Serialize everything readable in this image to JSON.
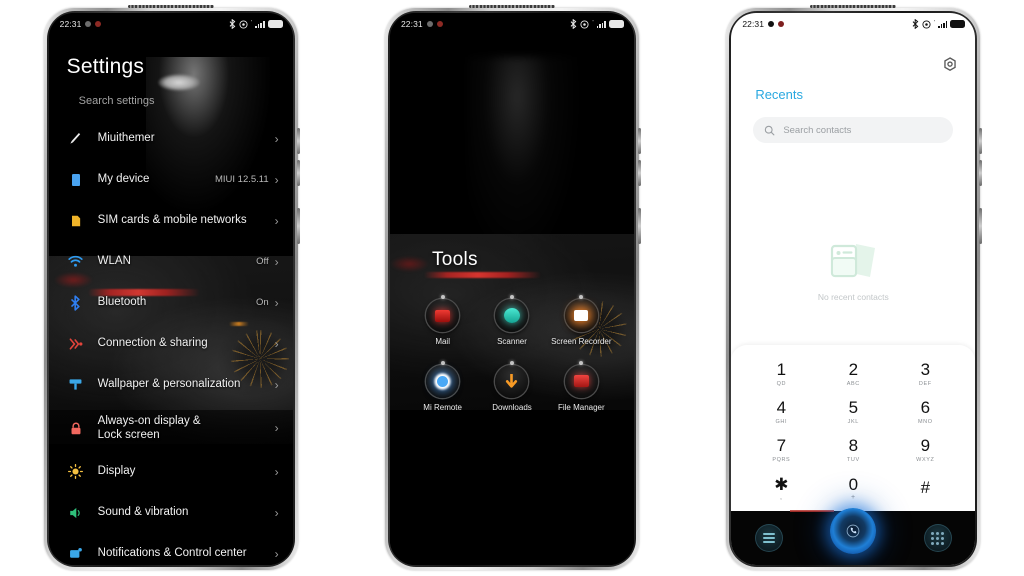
{
  "statusbar": {
    "time": "22:31",
    "icons_left": [
      "status-dot-gray",
      "status-dot-red"
    ],
    "icons_right": [
      "bluetooth-icon",
      "dnd-icon",
      "signal-icon",
      "battery-icon"
    ]
  },
  "phone1": {
    "name": "settings-screen",
    "title": "Settings",
    "search_placeholder": "Search settings",
    "items": [
      {
        "label": "Miuithemer",
        "value": "",
        "icon": "brush-icon",
        "color": "#e8e8e8"
      },
      {
        "label": "My device",
        "value": "MIUI 12.5.11",
        "icon": "device-icon",
        "color": "#4aa3f0"
      },
      {
        "label": "SIM cards & mobile networks",
        "value": "",
        "icon": "sim-card-icon",
        "color": "#f0b429"
      },
      {
        "label": "WLAN",
        "value": "Off",
        "icon": "wifi-icon",
        "color": "#2f9bf0"
      },
      {
        "label": "Bluetooth",
        "value": "On",
        "icon": "bluetooth-icon",
        "color": "#2f7ef0"
      },
      {
        "label": "Connection & sharing",
        "value": "",
        "icon": "connection-icon",
        "color": "#e2443b"
      },
      {
        "label": "Wallpaper & personalization",
        "value": "",
        "icon": "wallpaper-icon",
        "color": "#3aa7e8"
      },
      {
        "label": "Always-on display & Lock screen",
        "value": "",
        "icon": "lock-icon",
        "color": "#f2685f"
      },
      {
        "label": "Display",
        "value": "",
        "icon": "brightness-icon",
        "color": "#f5c141"
      },
      {
        "label": "Sound & vibration",
        "value": "",
        "icon": "volume-icon",
        "color": "#2fc07a"
      },
      {
        "label": "Notifications & Control center",
        "value": "",
        "icon": "notification-icon",
        "color": "#3aa7e8"
      }
    ],
    "chevron": "›"
  },
  "phone2": {
    "name": "tools-folder-screen",
    "folder_title": "Tools",
    "apps": [
      {
        "label": "Mail",
        "icon": "mail-icon",
        "color": "#d4201d"
      },
      {
        "label": "Scanner",
        "icon": "scanner-icon",
        "color": "#2fd6c2"
      },
      {
        "label": "Screen Recorder",
        "icon": "screen-recorder-icon",
        "color": "#f07c1e"
      },
      {
        "label": "Mi Remote",
        "icon": "mi-remote-icon",
        "color": "#1f8ae0"
      },
      {
        "label": "Downloads",
        "icon": "download-icon",
        "color": "#f0921e"
      },
      {
        "label": "File Manager",
        "icon": "file-manager-icon",
        "color": "#d4201d"
      }
    ]
  },
  "phone3": {
    "name": "dialer-screen",
    "tab_title": "Recents",
    "tab_color": "#29a8e0",
    "settings_icon": "gear-icon",
    "search_placeholder": "Search contacts",
    "empty_state": {
      "icon": "no-contacts-illustration",
      "text": "No recent contacts"
    },
    "keypad": [
      {
        "num": "1",
        "sub": "QD"
      },
      {
        "num": "2",
        "sub": "ABC"
      },
      {
        "num": "3",
        "sub": "DEF"
      },
      {
        "num": "4",
        "sub": "GHI"
      },
      {
        "num": "5",
        "sub": "JKL"
      },
      {
        "num": "6",
        "sub": "MNO"
      },
      {
        "num": "7",
        "sub": "PQRS"
      },
      {
        "num": "8",
        "sub": "TUV"
      },
      {
        "num": "9",
        "sub": "WXYZ"
      },
      {
        "num": "✱",
        "sub": ","
      },
      {
        "num": "0",
        "sub": "+"
      },
      {
        "num": "#",
        "sub": ""
      }
    ],
    "navbar": [
      {
        "icon": "menu-list-icon"
      },
      {
        "icon": "call-button-icon"
      },
      {
        "icon": "keypad-grid-icon"
      }
    ]
  }
}
